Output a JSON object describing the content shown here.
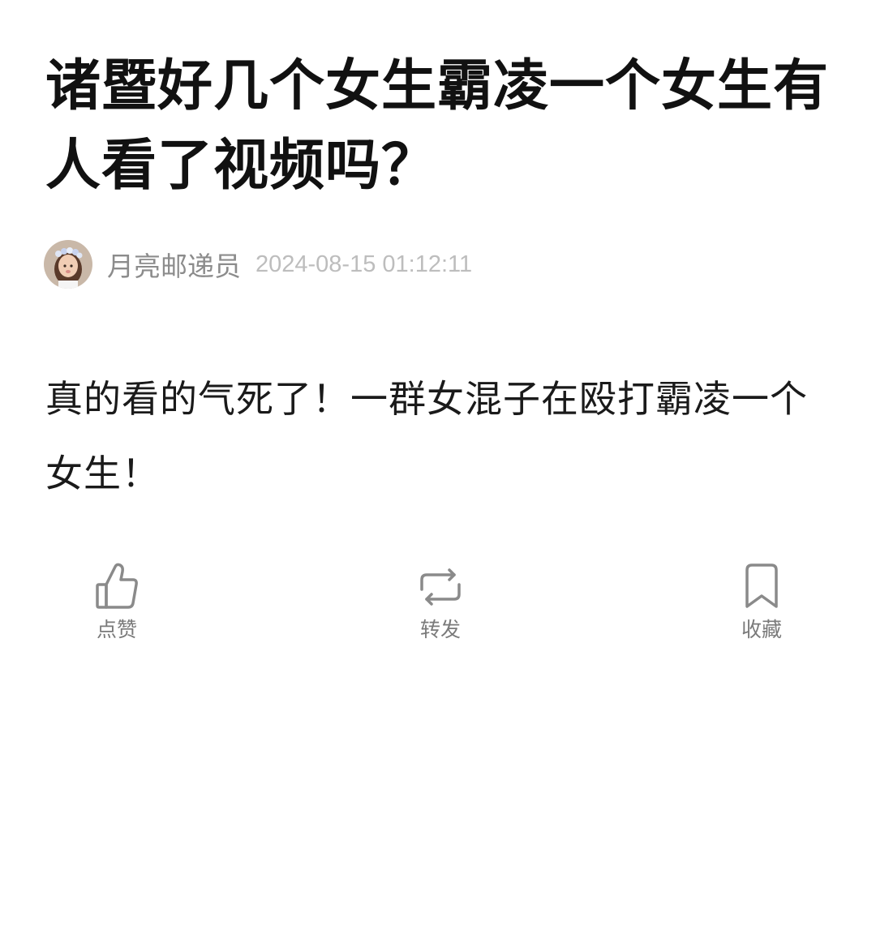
{
  "post": {
    "title": "诸暨好几个女生霸凌一个女生有人看了视频吗？",
    "author": {
      "name": "月亮邮递员",
      "avatar_icon": "avatar-photo"
    },
    "timestamp": "2024-08-15 01:12:11",
    "body": "真的看的气死了！一群女混子在殴打霸凌一个女生！"
  },
  "actions": [
    {
      "label": "点赞",
      "icon": "thumbs-up-icon"
    },
    {
      "label": "转发",
      "icon": "repost-icon"
    },
    {
      "label": "收藏",
      "icon": "bookmark-icon"
    }
  ],
  "colors": {
    "title": "#111111",
    "author": "#8c8c8c",
    "timestamp": "#bdbdbd",
    "icon": "#8a8a8a",
    "action_label": "#7a7a7a"
  }
}
